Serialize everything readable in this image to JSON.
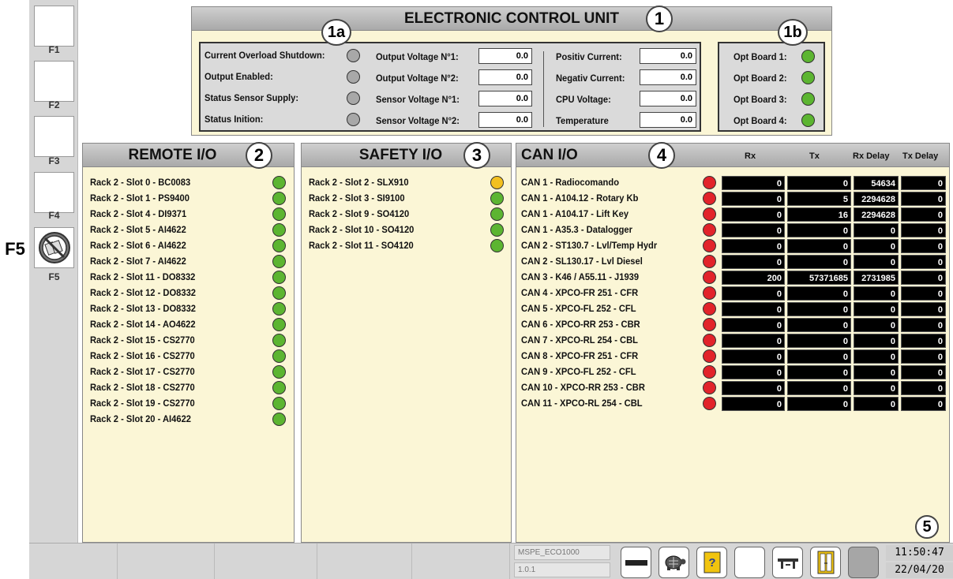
{
  "sidebar": {
    "keys": [
      {
        "label": "F1"
      },
      {
        "label": "F2"
      },
      {
        "label": "F3"
      },
      {
        "label": "F4"
      },
      {
        "label": "F5",
        "icon": "no-modules-icon"
      }
    ],
    "callout_f5": "F5"
  },
  "ecu": {
    "title": "ELECTRONIC CONTROL UNIT",
    "callout": "1",
    "callout_a": "1a",
    "callout_b": "1b",
    "status": [
      {
        "label": "Current Overload Shutdown:",
        "state": "grey"
      },
      {
        "label": "Output Enabled:",
        "state": "grey"
      },
      {
        "label": "Status Sensor Supply:",
        "state": "grey"
      },
      {
        "label": "Status Inition:",
        "state": "grey"
      }
    ],
    "voltages": [
      {
        "label": "Output Voltage N°1:",
        "value": "0.0"
      },
      {
        "label": "Output Voltage N°2:",
        "value": "0.0"
      },
      {
        "label": "Sensor Voltage N°1:",
        "value": "0.0"
      },
      {
        "label": "Sensor Voltage N°2:",
        "value": "0.0"
      }
    ],
    "measures": [
      {
        "label": "Positiv Current:",
        "value": "0.0"
      },
      {
        "label": "Negativ Current:",
        "value": "0.0"
      },
      {
        "label": "CPU Voltage:",
        "value": "0.0"
      },
      {
        "label": "Temperature",
        "value": "0.0"
      }
    ],
    "opt_boards": [
      {
        "label": "Opt Board 1:",
        "state": "green"
      },
      {
        "label": "Opt Board 2:",
        "state": "green"
      },
      {
        "label": "Opt Board 3:",
        "state": "green"
      },
      {
        "label": "Opt Board 4:",
        "state": "green"
      }
    ]
  },
  "remote_io": {
    "title": "REMOTE I/O",
    "callout": "2",
    "rows": [
      {
        "label": "Rack 2 - Slot 0 - BC0083",
        "state": "green"
      },
      {
        "label": "Rack 2 - Slot 1 - PS9400",
        "state": "green"
      },
      {
        "label": "Rack 2 - Slot 4 - DI9371",
        "state": "green"
      },
      {
        "label": "Rack 2 - Slot 5 - AI4622",
        "state": "green"
      },
      {
        "label": "Rack 2 - Slot 6 - AI4622",
        "state": "green"
      },
      {
        "label": "Rack 2 - Slot 7 - AI4622",
        "state": "green"
      },
      {
        "label": "Rack 2 - Slot 11 - DO8332",
        "state": "green"
      },
      {
        "label": "Rack 2 - Slot 12 - DO8332",
        "state": "green"
      },
      {
        "label": "Rack 2 - Slot 13 - DO8332",
        "state": "green"
      },
      {
        "label": "Rack 2 - Slot 14 - AO4622",
        "state": "green"
      },
      {
        "label": "Rack 2 - Slot 15 - CS2770",
        "state": "green"
      },
      {
        "label": "Rack 2 - Slot 16 - CS2770",
        "state": "green"
      },
      {
        "label": "Rack 2 - Slot 17 - CS2770",
        "state": "green"
      },
      {
        "label": "Rack 2 - Slot 18 - CS2770",
        "state": "green"
      },
      {
        "label": "Rack 2 - Slot 19 - CS2770",
        "state": "green"
      },
      {
        "label": "Rack 2 - Slot 20 - AI4622",
        "state": "green"
      }
    ]
  },
  "safety_io": {
    "title": "SAFETY I/O",
    "callout": "3",
    "rows": [
      {
        "label": "Rack 2 - Slot 2 - SLX910",
        "state": "yellow"
      },
      {
        "label": "Rack 2 - Slot 3 - SI9100",
        "state": "green"
      },
      {
        "label": "Rack 2 - Slot 9 - SO4120",
        "state": "green"
      },
      {
        "label": "Rack 2 - Slot 10 - SO4120",
        "state": "green"
      },
      {
        "label": "Rack 2 - Slot 11 - SO4120",
        "state": "green"
      }
    ]
  },
  "can_io": {
    "title": "CAN I/O",
    "callout": "4",
    "columns": [
      "Rx",
      "Tx",
      "Rx Delay",
      "Tx Delay"
    ],
    "rows": [
      {
        "label": "CAN 1 - Radiocomando",
        "state": "red",
        "rx": "0",
        "tx": "0",
        "rx_delay": "54634",
        "tx_delay": "0"
      },
      {
        "label": "CAN 1 - A104.12 - Rotary Kb",
        "state": "red",
        "rx": "0",
        "tx": "5",
        "rx_delay": "2294628",
        "tx_delay": "0"
      },
      {
        "label": "CAN 1 - A104.17 - Lift Key",
        "state": "red",
        "rx": "0",
        "tx": "16",
        "rx_delay": "2294628",
        "tx_delay": "0"
      },
      {
        "label": "CAN 1 - A35.3 - Datalogger",
        "state": "red",
        "rx": "0",
        "tx": "0",
        "rx_delay": "0",
        "tx_delay": "0"
      },
      {
        "label": "CAN 2 - ST130.7 - Lvl/Temp Hydr",
        "state": "red",
        "rx": "0",
        "tx": "0",
        "rx_delay": "0",
        "tx_delay": "0"
      },
      {
        "label": "CAN 2 - SL130.17 - Lvl Diesel",
        "state": "red",
        "rx": "0",
        "tx": "0",
        "rx_delay": "0",
        "tx_delay": "0"
      },
      {
        "label": "CAN 3 - K46 / A55.11 - J1939",
        "state": "red",
        "rx": "200",
        "tx": "57371685",
        "rx_delay": "2731985",
        "tx_delay": "0"
      },
      {
        "label": "CAN 4 - XPCO-FR 251 - CFR",
        "state": "red",
        "rx": "0",
        "tx": "0",
        "rx_delay": "0",
        "tx_delay": "0"
      },
      {
        "label": "CAN 5 - XPCO-FL 252 -  CFL",
        "state": "red",
        "rx": "0",
        "tx": "0",
        "rx_delay": "0",
        "tx_delay": "0"
      },
      {
        "label": "CAN 6 - XPCO-RR 253 -  CBR",
        "state": "red",
        "rx": "0",
        "tx": "0",
        "rx_delay": "0",
        "tx_delay": "0"
      },
      {
        "label": "CAN 7 - XPCO-RL 254 -  CBL",
        "state": "red",
        "rx": "0",
        "tx": "0",
        "rx_delay": "0",
        "tx_delay": "0"
      },
      {
        "label": "CAN 8 - XPCO-FR 251 -  CFR",
        "state": "red",
        "rx": "0",
        "tx": "0",
        "rx_delay": "0",
        "tx_delay": "0"
      },
      {
        "label": "CAN 9 - XPCO-FL 252 - CFL",
        "state": "red",
        "rx": "0",
        "tx": "0",
        "rx_delay": "0",
        "tx_delay": "0"
      },
      {
        "label": "CAN 10 - XPCO-RR 253 - CBR",
        "state": "red",
        "rx": "0",
        "tx": "0",
        "rx_delay": "0",
        "tx_delay": "0"
      },
      {
        "label": "CAN 11 - XPCO-RL 254 - CBL",
        "state": "red",
        "rx": "0",
        "tx": "0",
        "rx_delay": "0",
        "tx_delay": "0"
      }
    ]
  },
  "statusbar": {
    "project": "MSPE_ECO1000",
    "version": "1.0.1",
    "time": "11:50:47",
    "date": "22/04/20",
    "callout": "5",
    "buttons": [
      "minus-icon",
      "turtle-icon",
      "help-icon",
      "blank-button",
      "bench-icon",
      "door-icon",
      "grey-button"
    ]
  },
  "colors": {
    "panel_bg": "#fbf6d6",
    "header_grey": "#a9a9a9",
    "led_green": "#5cb531",
    "led_red": "#e2232a",
    "led_yellow": "#f3c01f",
    "led_grey": "#a8a8a8"
  }
}
